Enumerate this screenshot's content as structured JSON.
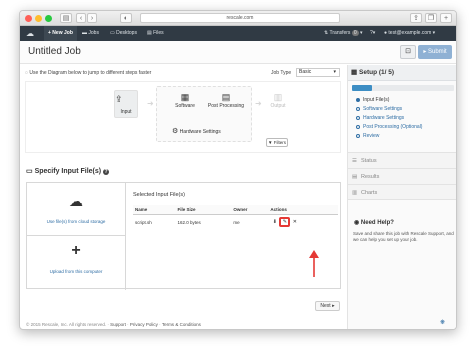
{
  "browser": {
    "url": "rescale.com",
    "back": "‹",
    "forward": "›"
  },
  "nav": {
    "items": [
      {
        "label": "+ New Job",
        "active": true
      },
      {
        "label": "Jobs"
      },
      {
        "label": "Desktops"
      },
      {
        "label": "Files"
      }
    ],
    "transfers": "Transfers",
    "transfers_count": "0",
    "user": "test@example.com"
  },
  "job": {
    "title": "Untitled Job",
    "submit": "Submit"
  },
  "diagram": {
    "hint": "Use the Diagram below to jump to different steps faster",
    "job_type_label": "Job Type",
    "job_type_value": "Basic",
    "input": "Input",
    "software": "Software",
    "post": "Post Processing",
    "hardware": "Hardware Settings",
    "output": "Output",
    "filters": "Filters"
  },
  "specify": {
    "title": "Specify Input File(s)",
    "cloud": "Use file(s) from cloud storage",
    "upload": "Upload from this computer",
    "selected_title": "Selected Input File(s)",
    "columns": [
      "Name",
      "File Size",
      "Owner",
      "Actions"
    ],
    "rows": [
      {
        "name": "script.sh",
        "size": "162.0 bytes",
        "owner": "me"
      }
    ],
    "next": "Next"
  },
  "footer": {
    "text": "© 2015 Rescale, Inc. All rights reserved.",
    "support": "Support",
    "privacy": "Privacy Policy",
    "terms": "Terms & Conditions"
  },
  "sidebar": {
    "setup": "Setup (1/ 5)",
    "progress": 0.2,
    "steps": [
      "Input File(s)",
      "Software Settings",
      "Hardware Settings",
      "Post Processing (Optional)",
      "Review"
    ],
    "status": "Status",
    "results": "Results",
    "charts": "Charts",
    "help_title": "Need Help?",
    "help_text": "Save and share this job with Rescale Support, and we can help you set up your job."
  },
  "colors": {
    "nav": "#303a44",
    "accent": "#2e6da4",
    "submit": "#8fb1d4",
    "highlight": "#e53935"
  }
}
